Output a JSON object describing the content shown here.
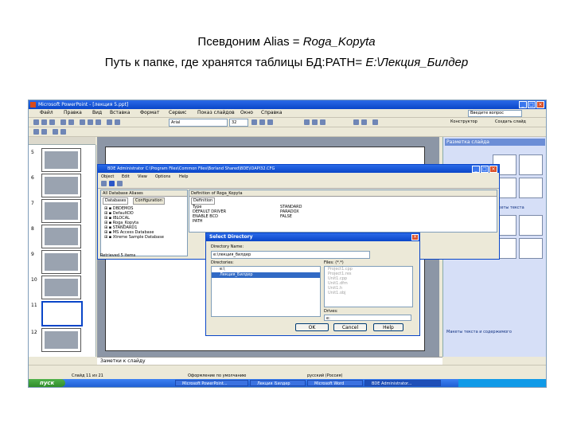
{
  "caption": {
    "line1_prefix": "Псевдоним Alias = ",
    "line1_value": "Roga_Kopyta",
    "line2_prefix": "Путь к папке, где хранятся таблицы БД:PATH= ",
    "line2_value": "E:\\Лекция_Билдер"
  },
  "powerpoint": {
    "title": "Microsoft PowerPoint - [лекция 5.ppt]",
    "menu": [
      "Файл",
      "Правка",
      "Вид",
      "Вставка",
      "Формат",
      "Сервис",
      "Показ слайдов",
      "Окно",
      "Справка"
    ],
    "help_placeholder": "Введите вопрос",
    "font_name": "Arial",
    "font_size": "32",
    "toolbar_right1": "Конструктор",
    "toolbar_right2": "Создать слайд",
    "slide_numbers": [
      "5",
      "6",
      "7",
      "8",
      "9",
      "10",
      "11",
      "12"
    ],
    "notes": "Заметки к слайду",
    "status_slide": "Слайд 11 из 21",
    "status_design": "Оформление по умолчанию",
    "status_lang": "русский (Россия)",
    "taskpane_title": "Разметка слайда",
    "taskpane_sub1": "Макеты текста",
    "taskpane_sub2": "Макеты текста и содержимого"
  },
  "bde": {
    "title": "BDE Administrator  C:\\Program Files\\Common Files\\Borland Shared\\BDE\\IDAPI32.CFG",
    "menu": [
      "Object",
      "Edit",
      "View",
      "Options",
      "Help"
    ],
    "all_aliases": "All Database Aliases",
    "definition_head": "Definition of Roga_Kopyta",
    "tab_databases": "Databases",
    "tab_configuration": "Configuration",
    "tree": [
      "DBDEMOS",
      "DefaultDD",
      "IBLOCAL",
      "Roga_Kopyta",
      "STANDARD1",
      "MS Access Database",
      "Xtreme Sample Database"
    ],
    "definition_tab": "Definition",
    "props": [
      {
        "k": "Type",
        "v": "STANDARD"
      },
      {
        "k": "DEFAULT DRIVER",
        "v": "PARADOX"
      },
      {
        "k": "ENABLE BCD",
        "v": "FALSE"
      },
      {
        "k": "PATH",
        "v": ""
      }
    ],
    "status": "Retrieved 5 items"
  },
  "dialog": {
    "title": "Select Directory",
    "dirname_label": "Directory Name:",
    "dirname_value": "e:\\лекция_билдер",
    "directories_label": "Directories:",
    "dirs": [
      "e:\\",
      "Лекция_Билдер"
    ],
    "files_label": "Files: (*.*)",
    "files": [
      "Project1.cpp",
      "Project1.res",
      "Unit1.cpp",
      "Unit1.dfm",
      "Unit1.h",
      "Unit1.obj"
    ],
    "drives_label": "Drives:",
    "drive_value": "e:",
    "ok": "OK",
    "cancel": "Cancel",
    "help": "Help"
  },
  "taskbar": {
    "start": "пуск",
    "tasks": [
      "Microsoft PowerPoint...",
      "Лекция_Билдер",
      "Microsoft Word",
      "BDE Administrator..."
    ]
  }
}
